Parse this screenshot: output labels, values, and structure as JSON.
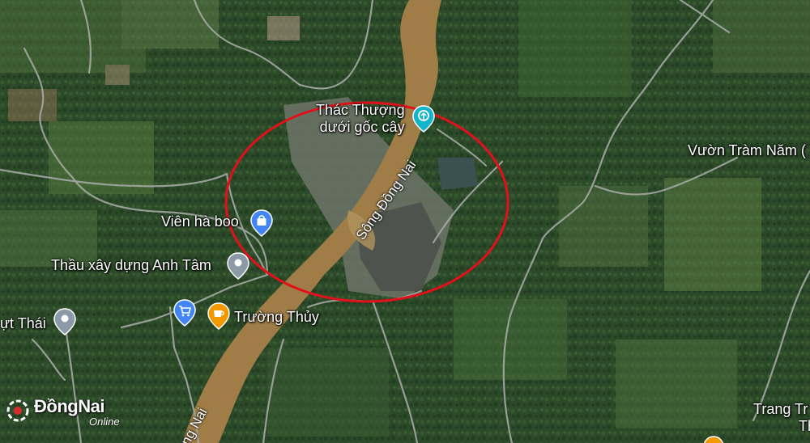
{
  "map": {
    "places": {
      "waterfall": [
        "Thác Thượng",
        "dưới gốc cây"
      ],
      "vien_ha_boo": "Viên hà boo",
      "thau_xay_dung": "Thầu xây dựng Anh Tâm",
      "truong_thuy": "Trường Thủy",
      "vuon_tram": "Vườn Tràm Năm (",
      "yt_thai": "ựt Thái",
      "trang_tr": "Trang Tr",
      "trang_th": "Th"
    },
    "river": {
      "label_main": "Sông Đồng Nai",
      "label_lower": "ồng Nai"
    },
    "highlight_circle_color": "#e3101b",
    "pin_colors": {
      "attraction": "#12b5cb",
      "shopping": "#4285f4",
      "generic": "#8a9aa6",
      "cafe": "#f29900"
    },
    "icons": [
      "attraction-icon",
      "shopping-bag-icon",
      "location-pin-icon",
      "cart-icon",
      "coffee-cup-icon"
    ]
  },
  "watermark": {
    "brand": "ĐồngNai",
    "sub": "Online"
  }
}
